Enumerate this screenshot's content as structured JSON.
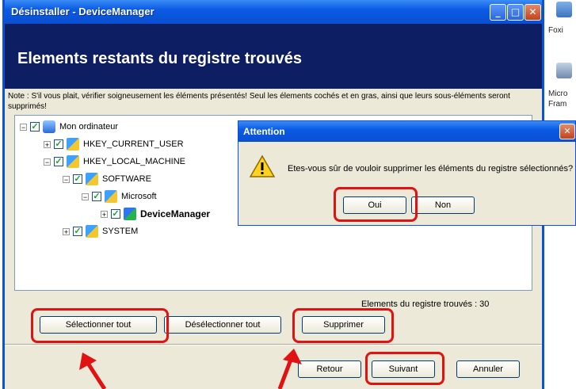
{
  "window": {
    "title": "Désinstaller - DeviceManager"
  },
  "header": {
    "title": "Elements restants du registre trouvés"
  },
  "note": "Note : S'il vous plait, vérifier soigneusement les éléments présentés! Seul les élements cochés et en gras, ainsi que leurs sous-éléments seront supprimés!",
  "tree": [
    {
      "label": "Mon ordinateur",
      "icon": "computer-icon",
      "checked": true
    },
    {
      "label": "HKEY_CURRENT_USER",
      "icon": "registry-folder-icon",
      "checked": true
    },
    {
      "label": "HKEY_LOCAL_MACHINE",
      "icon": "registry-folder-icon",
      "checked": true
    },
    {
      "label": "SOFTWARE",
      "icon": "registry-folder-icon",
      "checked": true
    },
    {
      "label": "Microsoft",
      "icon": "registry-folder-icon",
      "checked": true
    },
    {
      "label": "DeviceManager",
      "icon": "device-manager-icon",
      "checked": true
    },
    {
      "label": "SYSTEM",
      "icon": "registry-folder-icon",
      "checked": true
    }
  ],
  "found_count_label": "Elements du registre trouvés : 30",
  "buttons": {
    "select_all": "Sélectionner tout",
    "deselect_all": "Désélectionner tout",
    "delete": "Supprimer",
    "back": "Retour",
    "next": "Suivant",
    "cancel": "Annuler"
  },
  "dialog": {
    "title": "Attention",
    "message": "Etes-vous sûr de vouloir supprimer les éléments du registre sélectionnés?",
    "yes": "Oui",
    "no": "Non"
  },
  "desktop": {
    "labels": [
      "Foxi",
      "Micro",
      "Fram"
    ]
  },
  "colors": {
    "header_bg": "#0d1e62",
    "title_bar": "#0b5be5",
    "highlight": "#e01212",
    "window_bg": "#ece9d8"
  }
}
